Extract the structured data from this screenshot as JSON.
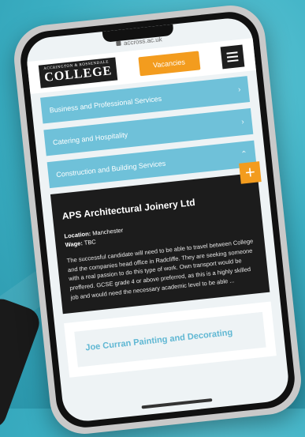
{
  "browser": {
    "url": "accross.ac.uk"
  },
  "header": {
    "logo_small": "ACCRINGTON & ROSSENDALE",
    "logo_big": "COLLEGE",
    "vacancies_label": "Vacancies"
  },
  "accordion": [
    {
      "label": "Business and Professional Services"
    },
    {
      "label": "Catering and Hospitality"
    },
    {
      "label": "Construction and Building Services"
    }
  ],
  "vacancy": {
    "title": "APS Architectural Joinery Ltd",
    "location_label": "Location:",
    "location": "Manchester",
    "wage_label": "Wage:",
    "wage": "TBC",
    "description": "The successful candidate will need to be able to travel between College and the companies head office in Radcliffe. They are seeking someone with a real passion to do this type of work. Own transport would be preffered. GCSE grade 4 or above preferred, as this is a highly skilled job and would need the necessary academic level to be able ..."
  },
  "vacancy2": {
    "title": "Joe Curran Painting and Decorating"
  },
  "colors": {
    "accent": "#f39c1e",
    "accordion": "#6fc1d9",
    "card": "#1c1c1c"
  }
}
